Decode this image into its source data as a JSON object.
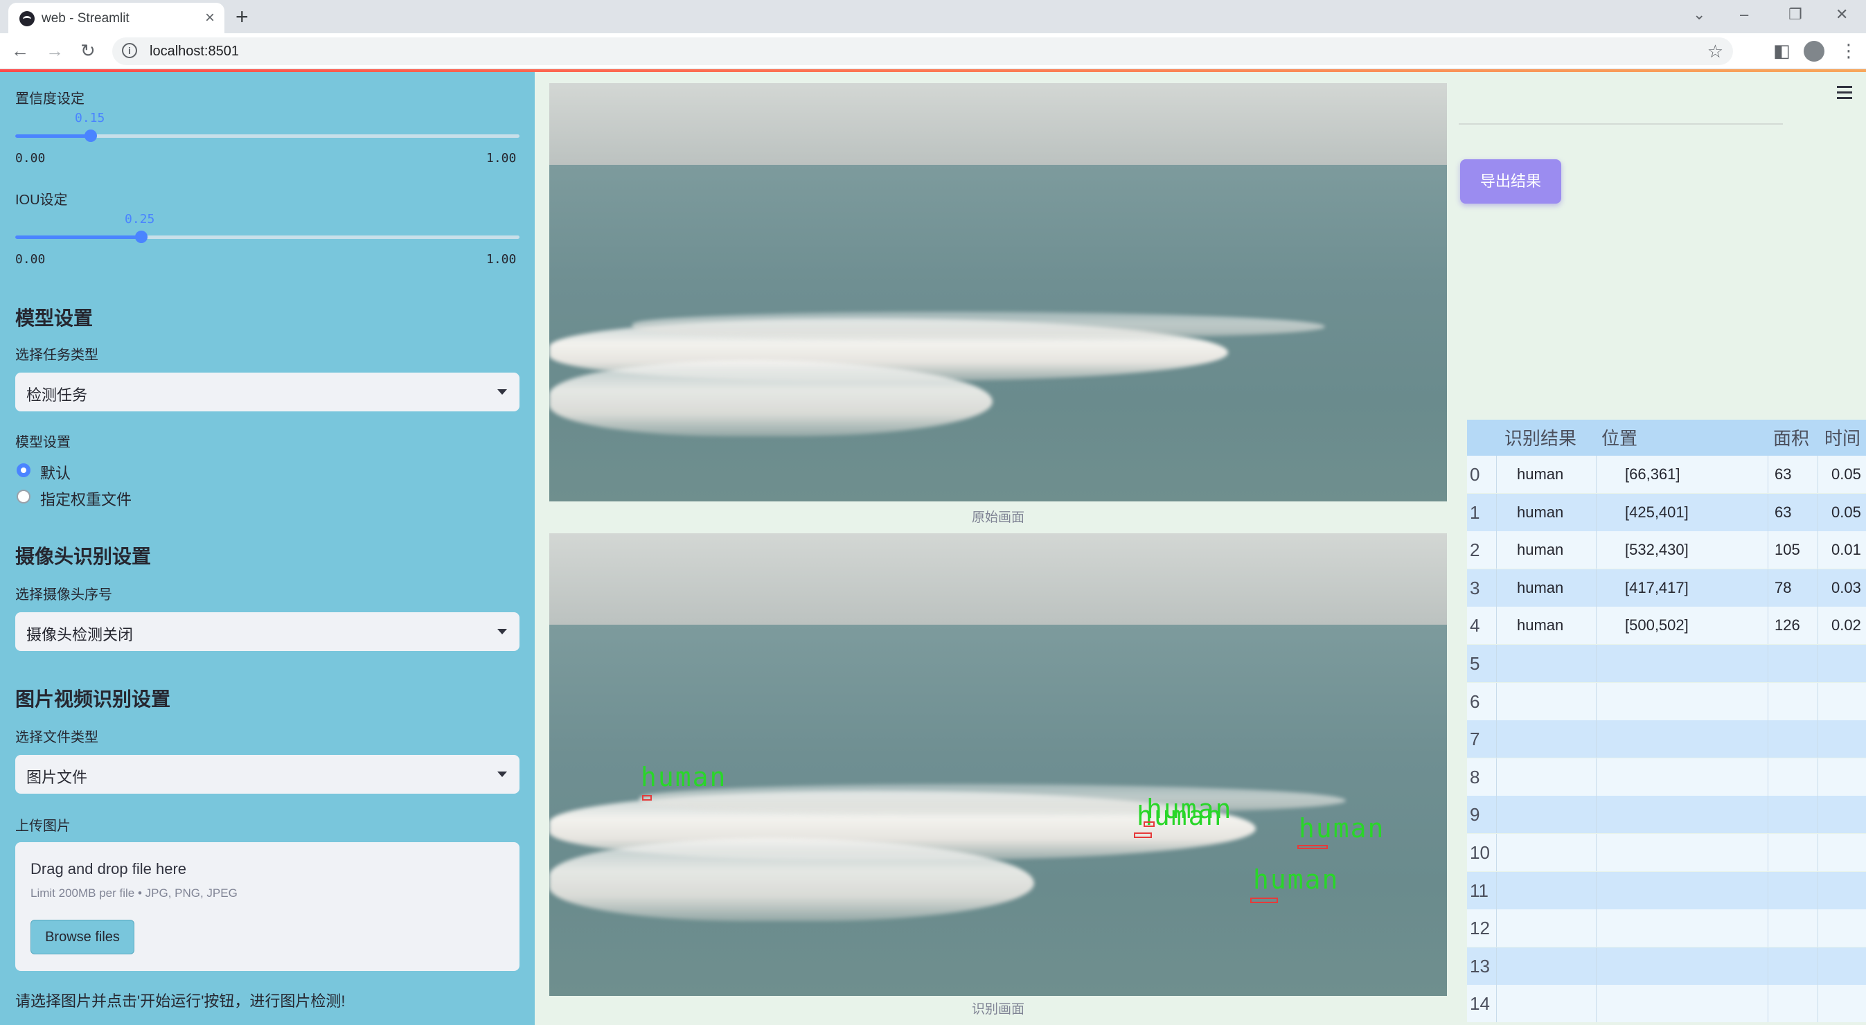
{
  "browser": {
    "tab_title": "web - Streamlit",
    "new_tab": "+",
    "url": "localhost:8501"
  },
  "sidebar": {
    "confidence": {
      "label": "置信度设定",
      "value": "0.15",
      "value_fraction": 0.15,
      "min": "0.00",
      "max": "1.00"
    },
    "iou": {
      "label": "IOU设定",
      "value": "0.25",
      "value_fraction": 0.25,
      "min": "0.00",
      "max": "1.00"
    },
    "model_section": {
      "heading": "模型设置",
      "task_label": "选择任务类型",
      "task_selected": "检测任务",
      "model_label": "模型设置",
      "options": [
        "默认",
        "指定权重文件"
      ],
      "selected_option": "默认"
    },
    "camera_section": {
      "heading": "摄像头识别设置",
      "camera_label": "选择摄像头序号",
      "camera_selected": "摄像头检测关闭"
    },
    "file_section": {
      "heading": "图片视频识别设置",
      "filetype_label": "选择文件类型",
      "filetype_selected": "图片文件",
      "upload_label": "上传图片",
      "drop_text": "Drag and drop file here",
      "limit_text": "Limit 200MB per file • JPG, PNG, JPEG",
      "browse_label": "Browse files"
    },
    "hint": "请选择图片并点击'开始运行'按钮，进行图片检测!"
  },
  "main": {
    "original_caption": "原始画面",
    "detected_caption": "识别画面",
    "detection_labels": [
      "human",
      "human",
      "human",
      "human",
      "human"
    ]
  },
  "results": {
    "export_label": "导出结果",
    "columns": [
      "识别结果",
      "位置",
      "面积",
      "时间"
    ],
    "rows": [
      {
        "index": "0",
        "result": "human",
        "position": "[66,361]",
        "area": "63",
        "time": "0.05"
      },
      {
        "index": "1",
        "result": "human",
        "position": "[425,401]",
        "area": "63",
        "time": "0.05"
      },
      {
        "index": "2",
        "result": "human",
        "position": "[532,430]",
        "area": "105",
        "time": "0.01"
      },
      {
        "index": "3",
        "result": "human",
        "position": "[417,417]",
        "area": "78",
        "time": "0.03"
      },
      {
        "index": "4",
        "result": "human",
        "position": "[500,502]",
        "area": "126",
        "time": "0.02"
      },
      {
        "index": "5",
        "result": "",
        "position": "",
        "area": "",
        "time": ""
      },
      {
        "index": "6",
        "result": "",
        "position": "",
        "area": "",
        "time": ""
      },
      {
        "index": "7",
        "result": "",
        "position": "",
        "area": "",
        "time": ""
      },
      {
        "index": "8",
        "result": "",
        "position": "",
        "area": "",
        "time": ""
      },
      {
        "index": "9",
        "result": "",
        "position": "",
        "area": "",
        "time": ""
      },
      {
        "index": "10",
        "result": "",
        "position": "",
        "area": "",
        "time": ""
      },
      {
        "index": "11",
        "result": "",
        "position": "",
        "area": "",
        "time": ""
      },
      {
        "index": "12",
        "result": "",
        "position": "",
        "area": "",
        "time": ""
      },
      {
        "index": "13",
        "result": "",
        "position": "",
        "area": "",
        "time": ""
      },
      {
        "index": "14",
        "result": "",
        "position": "",
        "area": "",
        "time": ""
      }
    ]
  },
  "colors": {
    "sidebar_bg": "#79c6dc",
    "accent": "#4a84ff",
    "export_button": "#9b8cf0",
    "table_stripe": "#cfe6fb",
    "table_header": "#b5d9f6",
    "detection_box": "#e53b3b",
    "detection_label": "#29d629"
  }
}
